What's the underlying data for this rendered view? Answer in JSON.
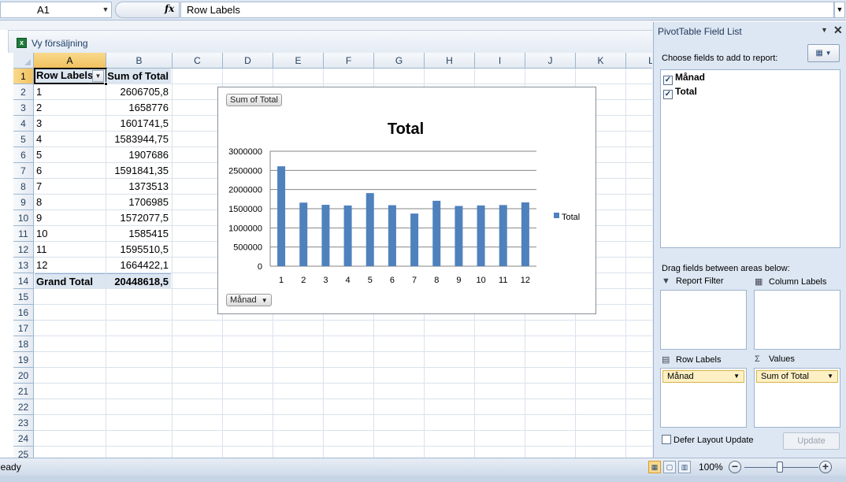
{
  "formula_bar": {
    "cell_ref": "A1",
    "fx": "fx",
    "formula": "Row Labels"
  },
  "workbook": {
    "title": "Vy försäljning",
    "columns": [
      "A",
      "B",
      "C",
      "D",
      "E",
      "F",
      "G",
      "H",
      "I",
      "J",
      "K",
      "L"
    ],
    "rows": [
      "1",
      "2",
      "3",
      "4",
      "5",
      "6",
      "7",
      "8",
      "9",
      "10",
      "11",
      "12",
      "13",
      "14",
      "15",
      "16",
      "17",
      "18",
      "19",
      "20",
      "21",
      "22",
      "23",
      "24",
      "25"
    ]
  },
  "pivot_table": {
    "header_a": "Row Labels",
    "header_b": "Sum of Total",
    "rows": [
      {
        "label": "1",
        "value": "2606705,8"
      },
      {
        "label": "2",
        "value": "1658776"
      },
      {
        "label": "3",
        "value": "1601741,5"
      },
      {
        "label": "4",
        "value": "1583944,75"
      },
      {
        "label": "5",
        "value": "1907686"
      },
      {
        "label": "6",
        "value": "1591841,35"
      },
      {
        "label": "7",
        "value": "1373513"
      },
      {
        "label": "8",
        "value": "1706985"
      },
      {
        "label": "9",
        "value": "1572077,5"
      },
      {
        "label": "10",
        "value": "1585415"
      },
      {
        "label": "11",
        "value": "1595510,5"
      },
      {
        "label": "12",
        "value": "1664422,1"
      }
    ],
    "grand_total_label": "Grand Total",
    "grand_total_value": "20448618,5"
  },
  "chart_buttons": {
    "values_button": "Sum of Total",
    "axis_button": "Månad"
  },
  "chart_data": {
    "type": "bar",
    "title": "Total",
    "xlabel": "",
    "ylabel": "",
    "categories": [
      "1",
      "2",
      "3",
      "4",
      "5",
      "6",
      "7",
      "8",
      "9",
      "10",
      "11",
      "12"
    ],
    "series": [
      {
        "name": "Total",
        "values": [
          2606705.8,
          1658776,
          1601741.5,
          1583944.75,
          1907686,
          1591841.35,
          1373513,
          1706985,
          1572077.5,
          1585415,
          1595510.5,
          1664422.1
        ]
      }
    ],
    "yticks": [
      "0",
      "500000",
      "1000000",
      "1500000",
      "2000000",
      "2500000",
      "3000000"
    ],
    "ylim": [
      0,
      3000000
    ],
    "grid": true,
    "legend": "right",
    "color": "#4f81bd"
  },
  "field_list": {
    "title": "PivotTable Field List",
    "choose_label": "Choose fields to add to report:",
    "fields": [
      {
        "label": "Månad",
        "checked": true
      },
      {
        "label": "Total",
        "checked": true
      }
    ],
    "drag_label": "Drag fields between areas below:",
    "report_filter": "Report Filter",
    "column_labels": "Column Labels",
    "row_labels": "Row Labels",
    "values": "Values",
    "row_chip": "Månad",
    "values_chip": "Sum of Total",
    "defer_label": "Defer Layout Update",
    "update_label": "Update"
  },
  "status_bar": {
    "status": "Ready",
    "zoom": "100%"
  },
  "icons": {
    "dropdown": "▼",
    "check": "✓",
    "close": "✕",
    "zoom_out": "−",
    "zoom_in": "+",
    "filter": "funnel-icon",
    "sigma": "Σ"
  }
}
